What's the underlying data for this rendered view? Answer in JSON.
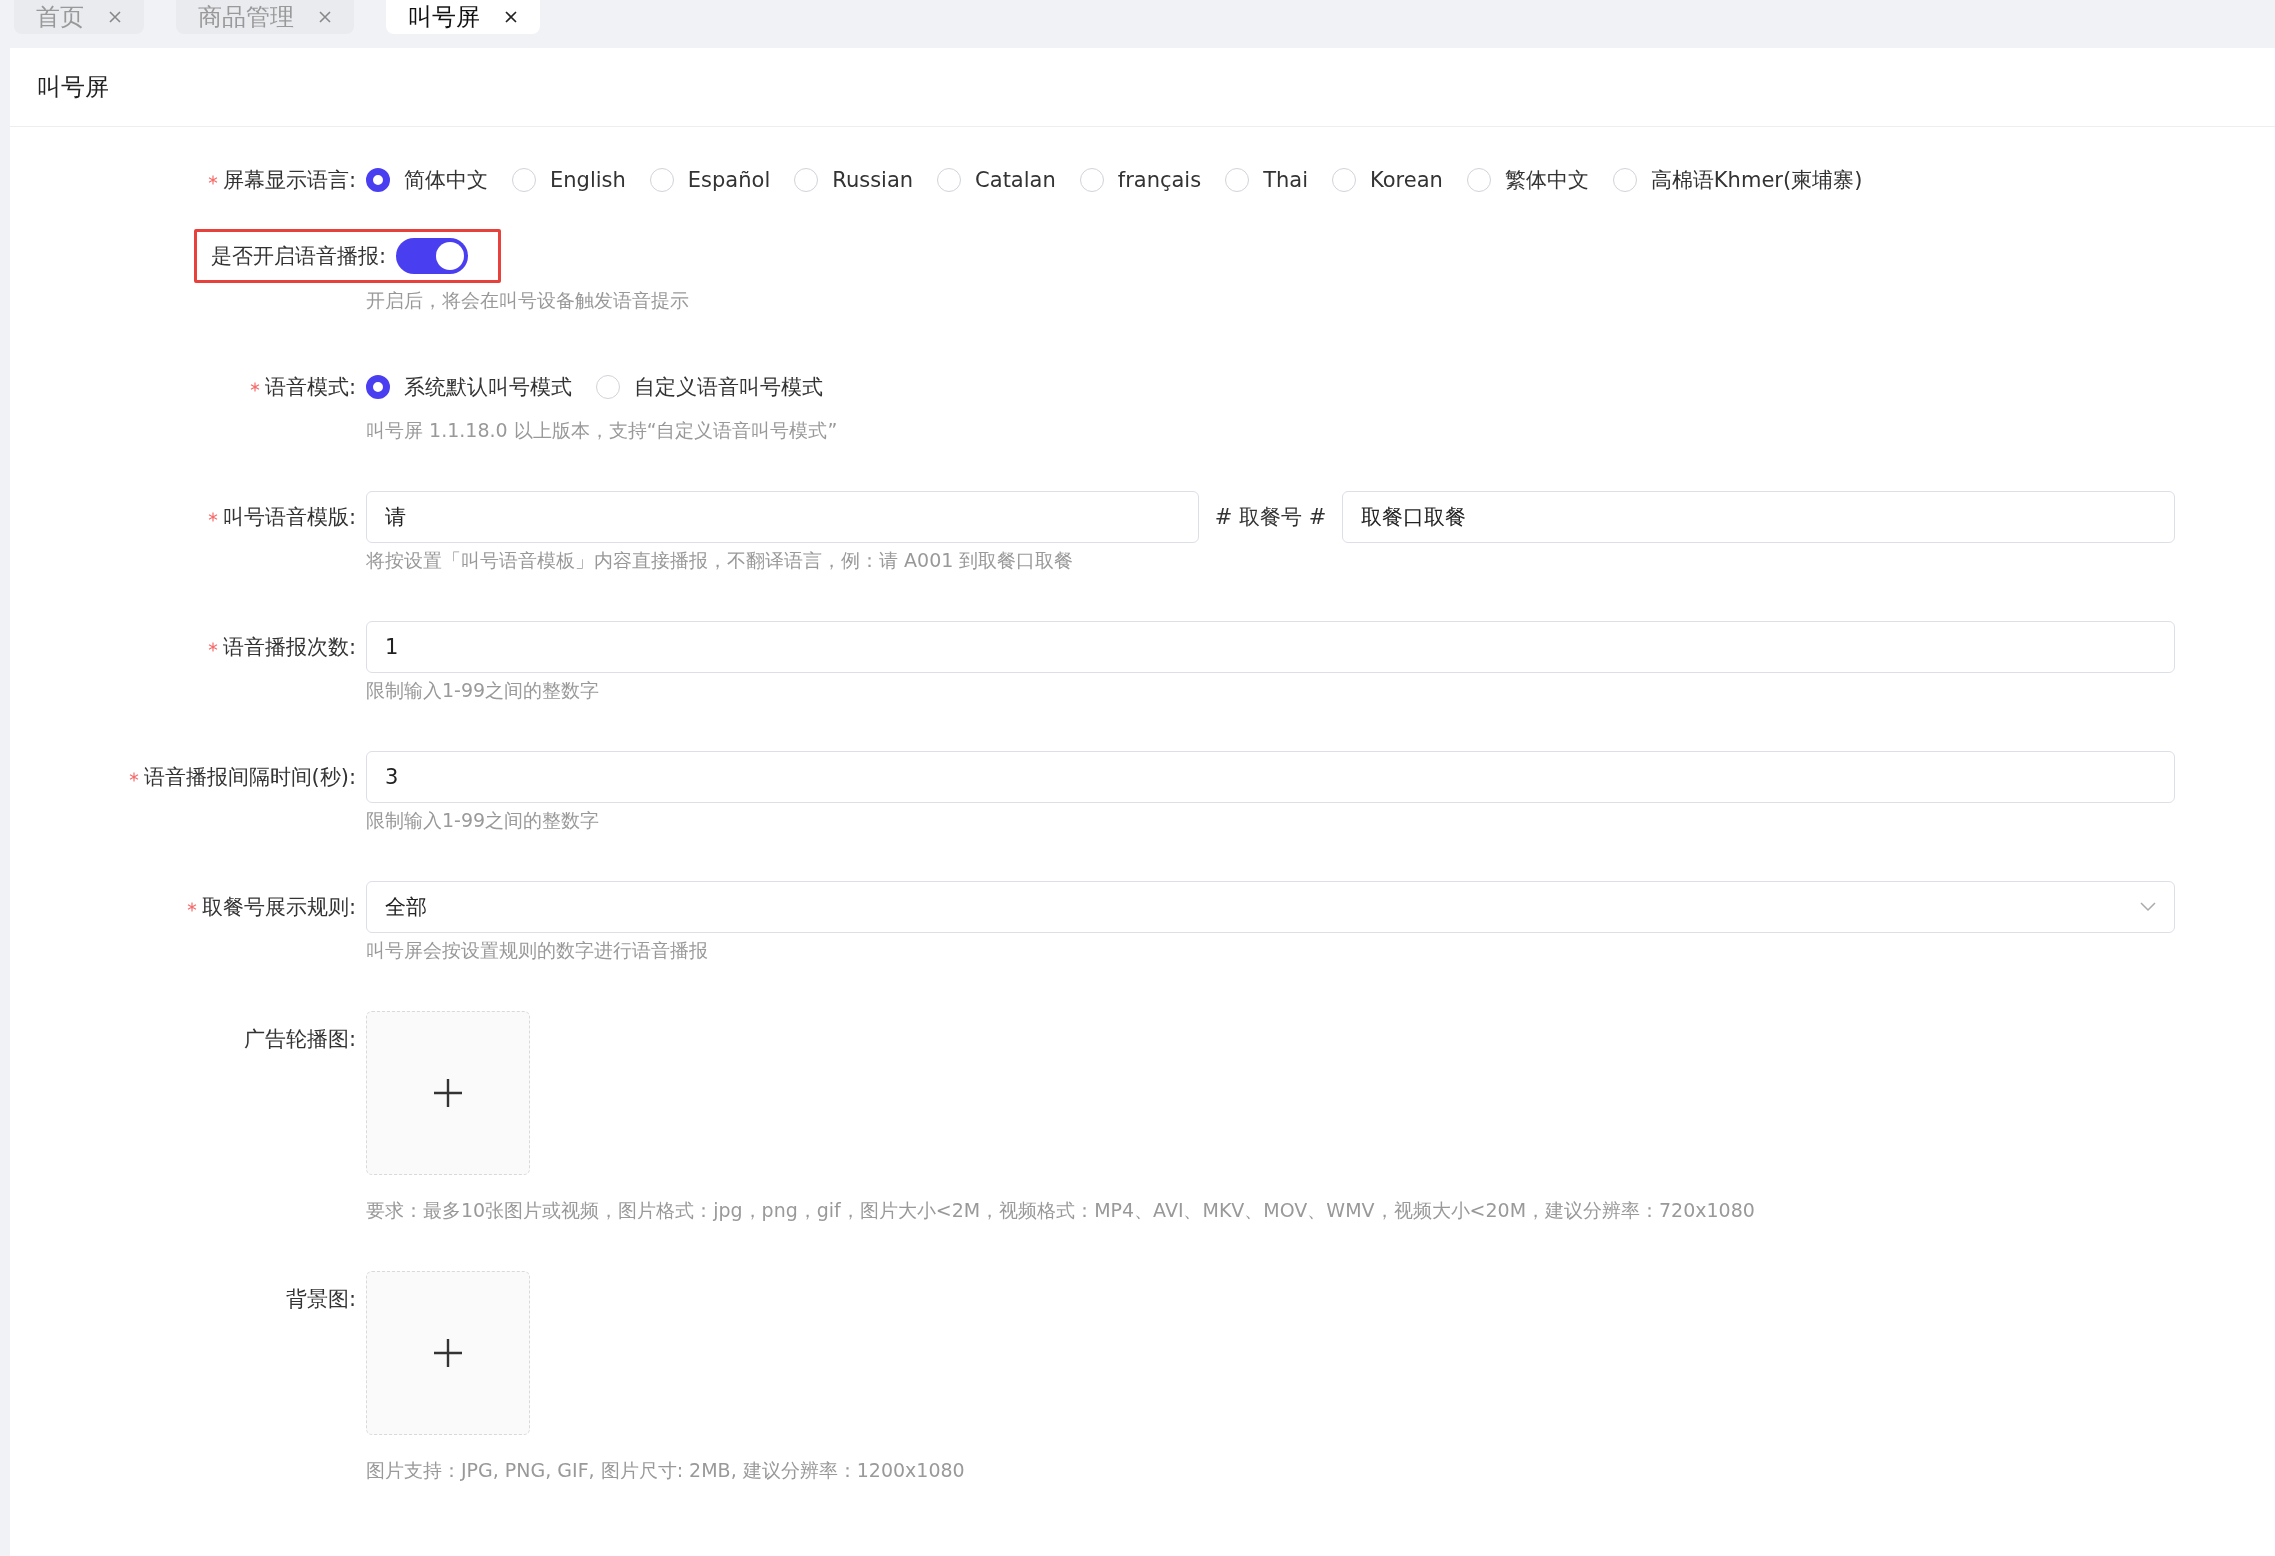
{
  "tabs": [
    {
      "label": "首页",
      "selected": false
    },
    {
      "label": "商品管理",
      "selected": false
    },
    {
      "label": "叫号屏",
      "selected": true
    }
  ],
  "page_title": "叫号屏",
  "form": [
    {
      "kind": "radio",
      "label": "屏幕显示语言:",
      "required": true,
      "options": [
        {
          "label": "简体中文",
          "selected": true
        },
        {
          "label": "English",
          "selected": false
        },
        {
          "label": "Español",
          "selected": false
        },
        {
          "label": "Russian",
          "selected": false
        },
        {
          "label": "Catalan",
          "selected": false
        },
        {
          "label": "français",
          "selected": false
        },
        {
          "label": "Thai",
          "selected": false
        },
        {
          "label": "Korean",
          "selected": false
        },
        {
          "label": "繁体中文",
          "selected": false
        },
        {
          "label": "高棉语Khmer(柬埔寨)",
          "selected": false
        }
      ]
    },
    {
      "kind": "switch",
      "label": "是否开启语音播报:",
      "required": false,
      "highlighted": true,
      "on": true,
      "hint": "开启后，将会在叫号设备触发语音提示"
    },
    {
      "kind": "radio",
      "label": "语音模式:",
      "required": true,
      "options": [
        {
          "label": "系统默认叫号模式",
          "selected": true
        },
        {
          "label": "自定义语音叫号模式",
          "selected": false
        }
      ],
      "hint": "叫号屏 1.1.18.0 以上版本，支持“自定义语音叫号模式”"
    },
    {
      "kind": "pair",
      "label": "叫号语音模版:",
      "required": true,
      "value": "请",
      "middle": "# 取餐号 #",
      "value2": "取餐口取餐",
      "hint": "将按设置「叫号语音模板」内容直接播报，不翻译语言，例：请 A001 到取餐口取餐"
    },
    {
      "kind": "input",
      "label": "语音播报次数:",
      "required": true,
      "value": "1",
      "hint": "限制输入1-99之间的整数字"
    },
    {
      "kind": "input",
      "label": "语音播报间隔时间(秒):",
      "required": true,
      "value": "3",
      "hint": "限制输入1-99之间的整数字"
    },
    {
      "kind": "select",
      "label": "取餐号展示规则:",
      "required": true,
      "value": "全部",
      "hint": "叫号屏会按设置规则的数字进行语音播报"
    },
    {
      "kind": "upload",
      "label": "广告轮播图:",
      "required": false,
      "hint": "要求：最多10张图片或视频，图片格式：jpg，png，gif，图片大小<2M，视频格式：MP4、AVI、MKV、MOV、WMV，视频大小<20M，建议分辨率：720x1080"
    },
    {
      "kind": "upload",
      "label": "背景图:",
      "required": false,
      "hint": "图片支持：JPG, PNG, GIF, 图片尺寸: 2MB, 建议分辨率：1200x1080"
    }
  ]
}
